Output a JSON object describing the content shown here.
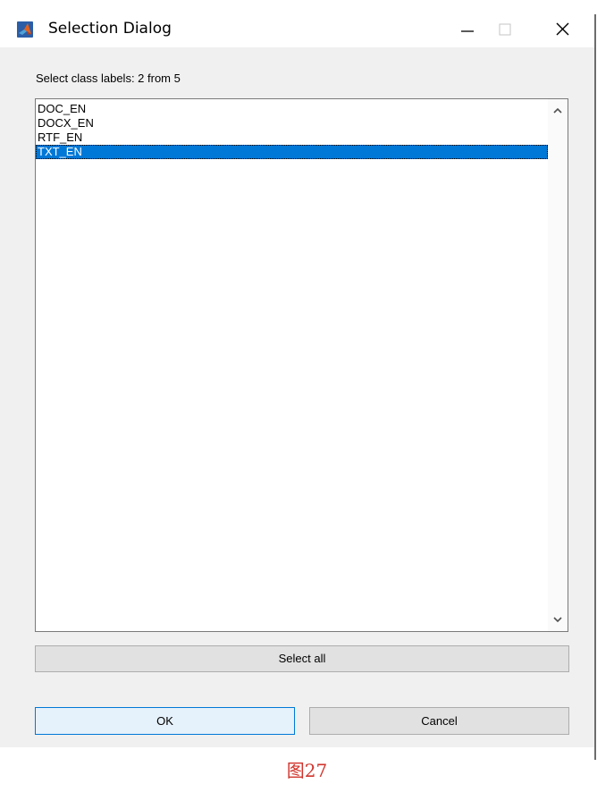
{
  "window": {
    "title": "Selection Dialog",
    "controls": {
      "minimize": "minimize",
      "maximize": "maximize",
      "close": "close"
    }
  },
  "prompt": "Select class labels: 2 from 5",
  "list": {
    "items": [
      {
        "label": "DOC_EN",
        "selected": false
      },
      {
        "label": "DOCX_EN",
        "selected": false
      },
      {
        "label": "RTF_EN",
        "selected": false
      },
      {
        "label": "TXT_EN",
        "selected": true
      }
    ]
  },
  "buttons": {
    "select_all": "Select all",
    "ok": "OK",
    "cancel": "Cancel"
  },
  "caption": "图27",
  "colors": {
    "selection": "#0078d7",
    "dialog_bg": "#f0f0f0",
    "caption": "#d0342c"
  }
}
